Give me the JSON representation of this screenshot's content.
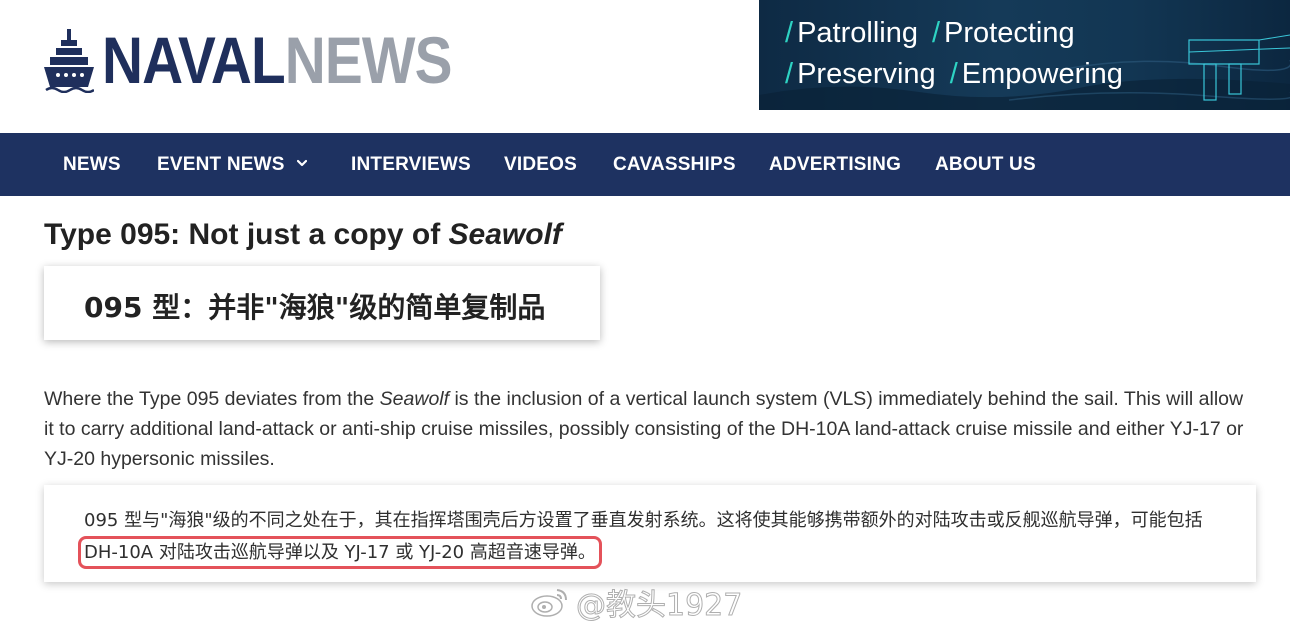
{
  "header": {
    "logo": {
      "part1": "NAVAL",
      "part2": "NEWS",
      "icon": "ship-icon"
    },
    "ad": {
      "line1": [
        "Patrolling",
        "Protecting"
      ],
      "line2": [
        "Preserving",
        "Empowering"
      ],
      "slash": "/",
      "accent_color": "#2ed3c3"
    }
  },
  "nav": {
    "items": [
      {
        "label": "NEWS"
      },
      {
        "label": "EVENT NEWS",
        "icon": "chevron-down-icon"
      },
      {
        "label": "INTERVIEWS"
      },
      {
        "label": "VIDEOS"
      },
      {
        "label": "CAVASSHIPS"
      },
      {
        "label": "ADVERTISING"
      },
      {
        "label": "ABOUT US"
      }
    ],
    "background": "#1e3261"
  },
  "article": {
    "title_prefix": "Type 095: Not just a copy of ",
    "title_em": "Seawolf",
    "cn_title": "095 型：并非\"海狼\"级的简单复制品",
    "para": {
      "part1": "Where the Type 095 deviates from the ",
      "em": "Seawolf",
      "part2": " is the inclusion of a vertical launch system (VLS) immediately behind the sail. This will allow it to carry additional land-attack or anti-ship cruise missiles, possibly consisting of the DH-10A land-attack cruise missile and either YJ-17 or YJ-20 hypersonic missiles."
    },
    "cn_para": {
      "part1": "095 型与\"海狼\"级的不同之处在于，其在指挥塔围壳后方设置了垂直发射系统。这将使其能够携带额外的对陆攻击或反舰巡航导弹，可能包括",
      "highlight": "DH-10A 对陆攻击巡航导弹以及 YJ-17 或 YJ-20 高超音速导弹。",
      "highlight_color": "#e4525a"
    }
  },
  "watermark": {
    "icon": "weibo-icon",
    "text": "@教头1927"
  },
  "colors": {
    "brand_navy": "#1f2f5c",
    "brand_gray": "#9aa0aa"
  }
}
